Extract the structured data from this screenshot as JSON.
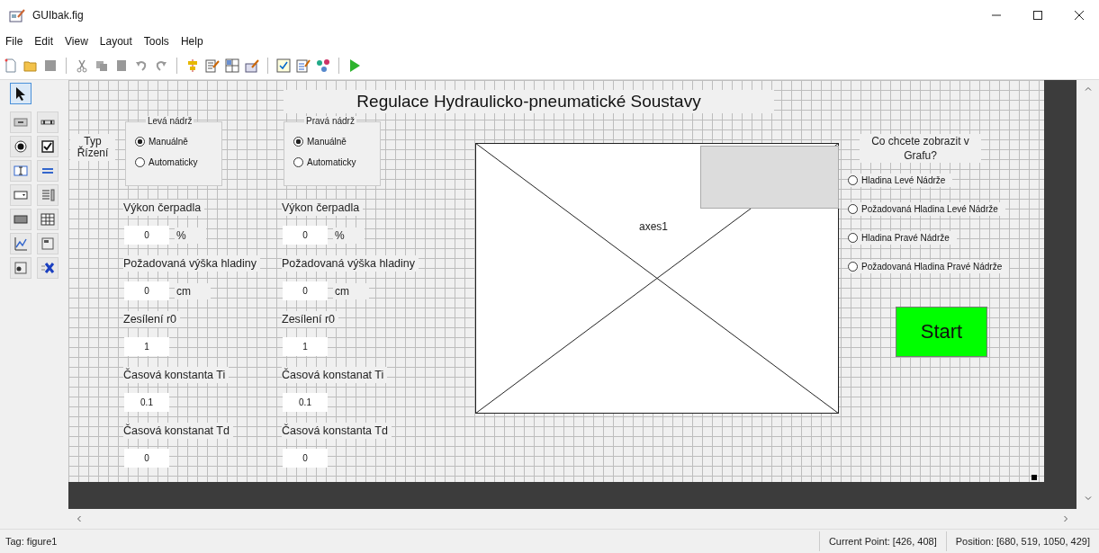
{
  "window": {
    "title": "GUIbak.fig"
  },
  "menu": [
    "File",
    "Edit",
    "View",
    "Layout",
    "Tools",
    "Help"
  ],
  "palette": [
    {
      "kind": "select",
      "selected": true
    },
    {
      "kind": "push-button",
      "selected": false
    },
    {
      "kind": "slider",
      "selected": false
    },
    {
      "kind": "radio",
      "selected": false
    },
    {
      "kind": "checkbox",
      "selected": false
    },
    {
      "kind": "edit",
      "selected": false
    },
    {
      "kind": "text",
      "selected": false
    },
    {
      "kind": "popup",
      "selected": false
    },
    {
      "kind": "listbox",
      "selected": false
    },
    {
      "kind": "toggle",
      "selected": false
    },
    {
      "kind": "table",
      "selected": false
    },
    {
      "kind": "axes",
      "selected": false
    },
    {
      "kind": "panel",
      "selected": false
    },
    {
      "kind": "button-group",
      "selected": false
    },
    {
      "kind": "activex",
      "selected": false
    }
  ],
  "canvas": {
    "title": "Regulace Hydraulicko-pneumatické Soustavy",
    "type_label": "Typ Řízení",
    "tanks": [
      {
        "title": "Levá nádrž",
        "modes": [
          {
            "label": "Manuálně",
            "selected": true
          },
          {
            "label": "Automaticky",
            "selected": false
          }
        ],
        "fields": [
          {
            "label": "Výkon čerpadla",
            "value": "0",
            "unit": "%"
          },
          {
            "label": "Požadovaná výška hladiny",
            "value": "0",
            "unit": "cm"
          },
          {
            "label": "Zesílení r0",
            "value": "1"
          },
          {
            "label": "Časová konstanta Ti",
            "value": "0.1"
          },
          {
            "label": "Časová konstanat Td",
            "value": "0"
          }
        ]
      },
      {
        "title": "Pravá nádrž",
        "modes": [
          {
            "label": "Manuálně",
            "selected": true
          },
          {
            "label": "Automaticky",
            "selected": false
          }
        ],
        "fields": [
          {
            "label": "Výkon čerpadla",
            "value": "0",
            "unit": "%"
          },
          {
            "label": "Požadovaná výška hladiny",
            "value": "0",
            "unit": "cm"
          },
          {
            "label": "Zesílení r0",
            "value": "1"
          },
          {
            "label": "Časová konstanat Ti",
            "value": "0.1"
          },
          {
            "label": "Časová konstanta Td",
            "value": "0"
          }
        ]
      }
    ],
    "axes": {
      "label": "axes1"
    },
    "plot_prompt": "Co chcete zobrazit v Grafu?",
    "plot_options": [
      {
        "label": "Hladina Levé Nádrže",
        "selected": false
      },
      {
        "label": "Požadovaná Hladina Levé Nádrže",
        "selected": false
      },
      {
        "label": "Hladina Pravé Nádrže",
        "selected": false
      },
      {
        "label": "Požadovaná Hladina Pravé Nádrže",
        "selected": false
      }
    ],
    "start_button": "Start"
  },
  "status_bar": {
    "tag": "Tag: figure1",
    "current_point": "Current Point:  [426, 408]",
    "position": "Position: [680, 519, 1050, 429]"
  }
}
